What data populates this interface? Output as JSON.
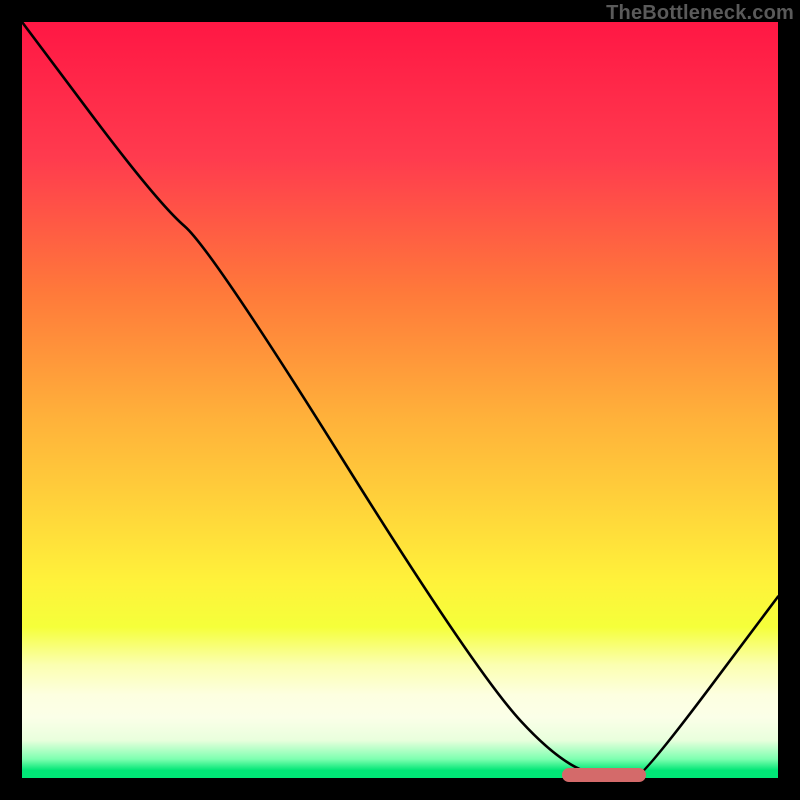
{
  "brand": "TheBottleneck.com",
  "chart_data": {
    "type": "line",
    "title": "",
    "xlabel": "",
    "ylabel": "",
    "xlim": [
      0,
      100
    ],
    "ylim": [
      0,
      100
    ],
    "x": [
      0,
      18,
      25,
      60,
      72,
      80,
      82,
      100
    ],
    "values": [
      100,
      76,
      70,
      14,
      1,
      0,
      0,
      24
    ],
    "marker": {
      "x_start": 72,
      "x_end": 82,
      "y": 0
    },
    "gradient_stops": [
      {
        "pos": 0,
        "color": "#ff1744"
      },
      {
        "pos": 18,
        "color": "#ff3b4e"
      },
      {
        "pos": 36,
        "color": "#ff7a3a"
      },
      {
        "pos": 52,
        "color": "#ffb03a"
      },
      {
        "pos": 64,
        "color": "#ffd33a"
      },
      {
        "pos": 74,
        "color": "#fff23a"
      },
      {
        "pos": 80,
        "color": "#f5ff3a"
      },
      {
        "pos": 85,
        "color": "#fbffb0"
      },
      {
        "pos": 89,
        "color": "#fdffe0"
      },
      {
        "pos": 92,
        "color": "#fbffe8"
      },
      {
        "pos": 95,
        "color": "#e9ffdd"
      },
      {
        "pos": 97.5,
        "color": "#7dffb0"
      },
      {
        "pos": 99,
        "color": "#00e676"
      },
      {
        "pos": 100,
        "color": "#00e676"
      }
    ]
  }
}
